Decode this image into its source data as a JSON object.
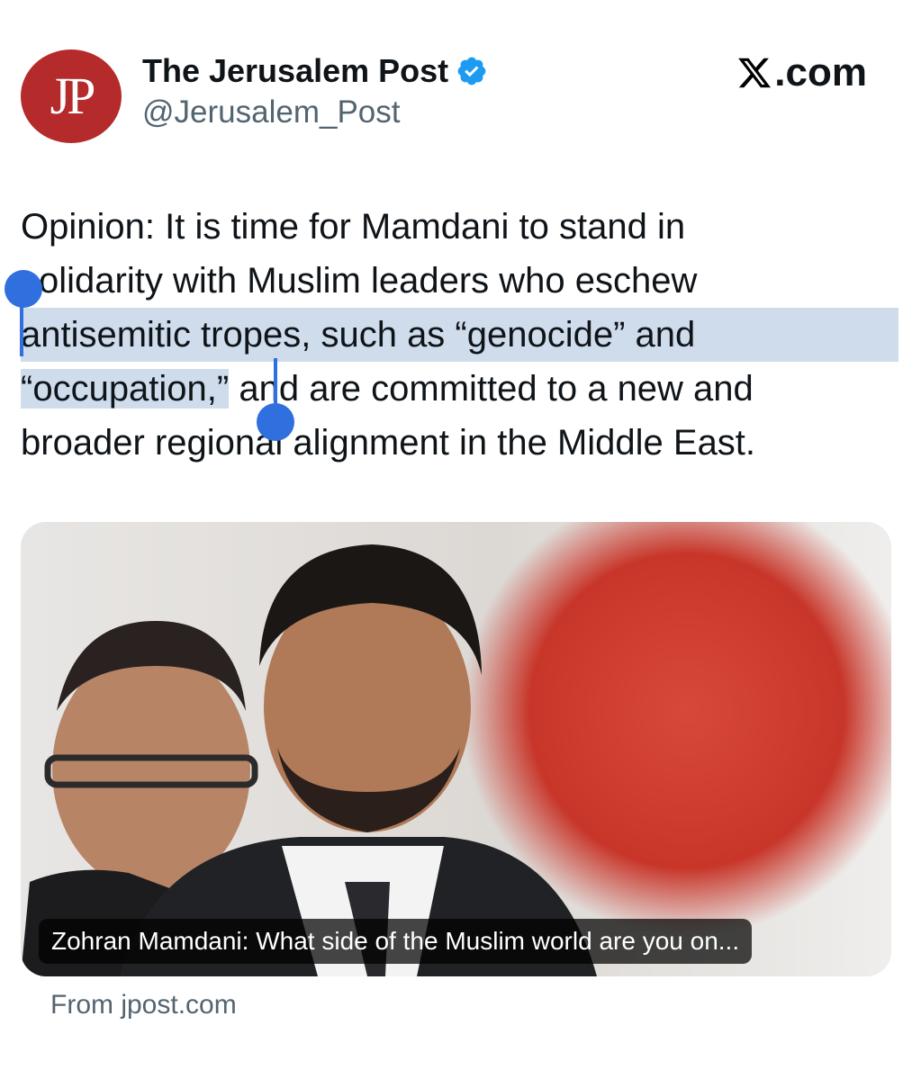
{
  "account": {
    "avatar_text": "JP",
    "display_name": "The Jerusalem Post",
    "handle": "@Jerusalem_Post",
    "verified_icon": "verified-badge-icon",
    "verified_color": "#1d9bf0"
  },
  "brand": {
    "icon": "x-logo-icon",
    "text": ".com"
  },
  "post": {
    "line1": "Opinion: It is time for Mamdani to stand in",
    "line2": "solidarity with Muslim leaders who eschew",
    "line3": "antisemitic tropes, such as “genocide” and",
    "line4_selected": "“occupation,”",
    "line4_rest": " and are committed to a new and",
    "line5": "broader regional alignment in the Middle East."
  },
  "selection": {
    "color": "#cfdcec",
    "handle_color": "#2f6fde"
  },
  "link_card": {
    "caption": "Zohran Mamdani: What side of the Muslim world are you on...",
    "source": "From jpost.com"
  }
}
